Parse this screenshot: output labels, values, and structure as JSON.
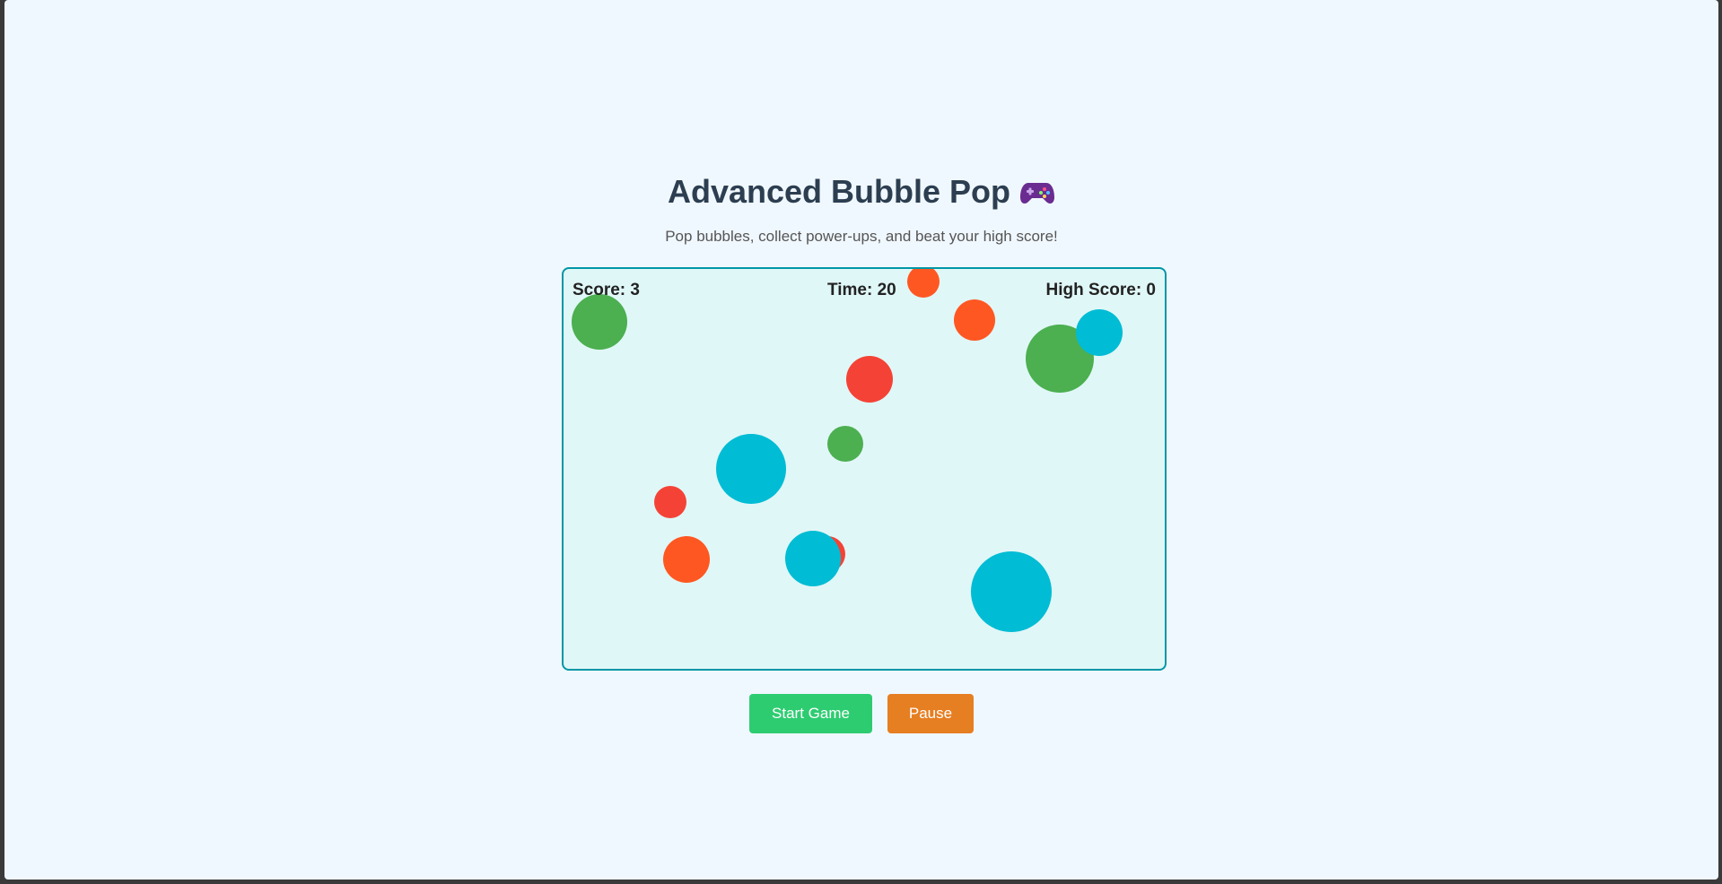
{
  "header": {
    "title": "Advanced Bubble Pop",
    "title_icon": "gamepad-icon",
    "subtitle": "Pop bubbles, collect power-ups, and beat your high score!"
  },
  "hud": {
    "score_label": "Score: 3",
    "time_label": "Time: 20",
    "high_score_label": "High Score: 0"
  },
  "controls": {
    "start_label": "Start Game",
    "pause_label": "Pause"
  },
  "colors": {
    "green": "#4caf50",
    "orange": "#ff5722",
    "red": "#f44336",
    "cyan": "#00bcd4",
    "start_button": "#2ecc71",
    "pause_button": "#e67e22",
    "board_border": "#0097a7",
    "board_bg": "#e0f7f7"
  },
  "bubbles": [
    {
      "type": "green"
    },
    {
      "type": "orange"
    },
    {
      "type": "orange"
    },
    {
      "type": "green"
    },
    {
      "type": "cyan"
    },
    {
      "type": "red"
    },
    {
      "type": "green"
    },
    {
      "type": "cyan"
    },
    {
      "type": "red"
    },
    {
      "type": "orange"
    },
    {
      "type": "red"
    },
    {
      "type": "cyan"
    },
    {
      "type": "cyan"
    }
  ]
}
